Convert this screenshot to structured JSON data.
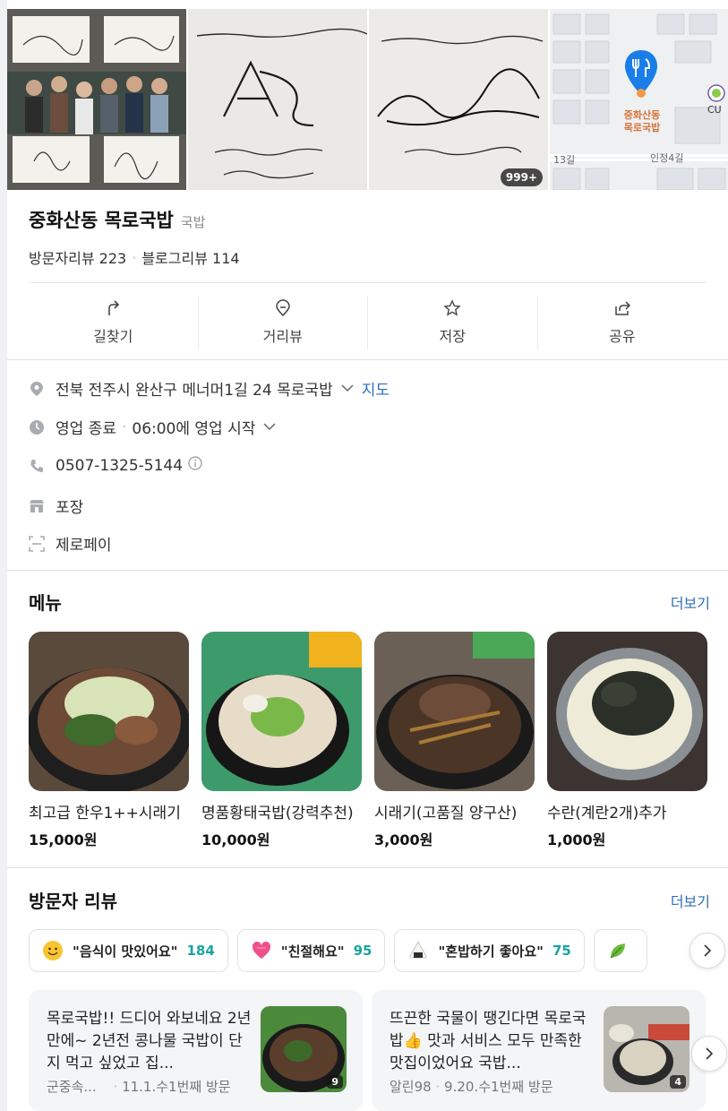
{
  "photos": {
    "count_badge": "999+"
  },
  "map": {
    "pin_label_line1": "중화산동",
    "pin_label_line2": "목로국밥",
    "road1": "13길",
    "road2": "인정4길",
    "store_brand": "CU"
  },
  "place": {
    "name": "중화산동 목로국밥",
    "category": "국밥",
    "visitor_reviews": "방문자리뷰 223",
    "blog_reviews": "블로그리뷰 114"
  },
  "actions": [
    {
      "label": "길찾기",
      "icon": "directions-icon"
    },
    {
      "label": "거리뷰",
      "icon": "street-view-icon"
    },
    {
      "label": "저장",
      "icon": "star-icon"
    },
    {
      "label": "공유",
      "icon": "share-icon"
    }
  ],
  "info": {
    "address": "전북 전주시 완산구 메너머1길 24 목로국밥",
    "map_link": "지도",
    "status": "영업 종료",
    "opening": "06:00에 영업 시작",
    "phone": "0507-1325-5144",
    "service": "포장",
    "payment": "제로페이"
  },
  "menu_section": {
    "title": "메뉴",
    "more": "더보기",
    "items": [
      {
        "name": "최고급 한우1++시래기",
        "price": "15,000원"
      },
      {
        "name": "명품황태국밥(강력추천)",
        "price": "10,000원"
      },
      {
        "name": "시래기(고품질 양구산)",
        "price": "3,000원"
      },
      {
        "name": "수란(계란2개)추가",
        "price": "1,000원"
      }
    ]
  },
  "review_section": {
    "title": "방문자 리뷰",
    "more": "더보기",
    "keywords": [
      {
        "text": "\"음식이 맛있어요\"",
        "count": "184",
        "emoji": "smile-emoji-icon"
      },
      {
        "text": "\"친절해요\"",
        "count": "95",
        "emoji": "heart-emoji-icon"
      },
      {
        "text": "\"혼밥하기 좋아요\"",
        "count": "75",
        "emoji": "rice-ball-emoji-icon"
      }
    ],
    "cards": [
      {
        "text": "목로국밥!! 드디어 와보네요 2년만에~ 2년전 콩나물 국밥이 단지 먹고 싶었고 집...",
        "author": "군중속...",
        "meta": "11.1.수1번째 방문",
        "photo_count": "9"
      },
      {
        "text": "뜨끈한 국물이 땡긴다면 목로국밥👍 맛과 서비스 모두 만족한 맛집이었어요 국밥...",
        "author": "알린98",
        "meta": "9.20.수1번째 방문",
        "photo_count": "4"
      }
    ]
  },
  "colors": {
    "accent_blue": "#2f6fb6",
    "keyword_count": "#19a4a0",
    "map_pin": "#1a7ee8"
  }
}
